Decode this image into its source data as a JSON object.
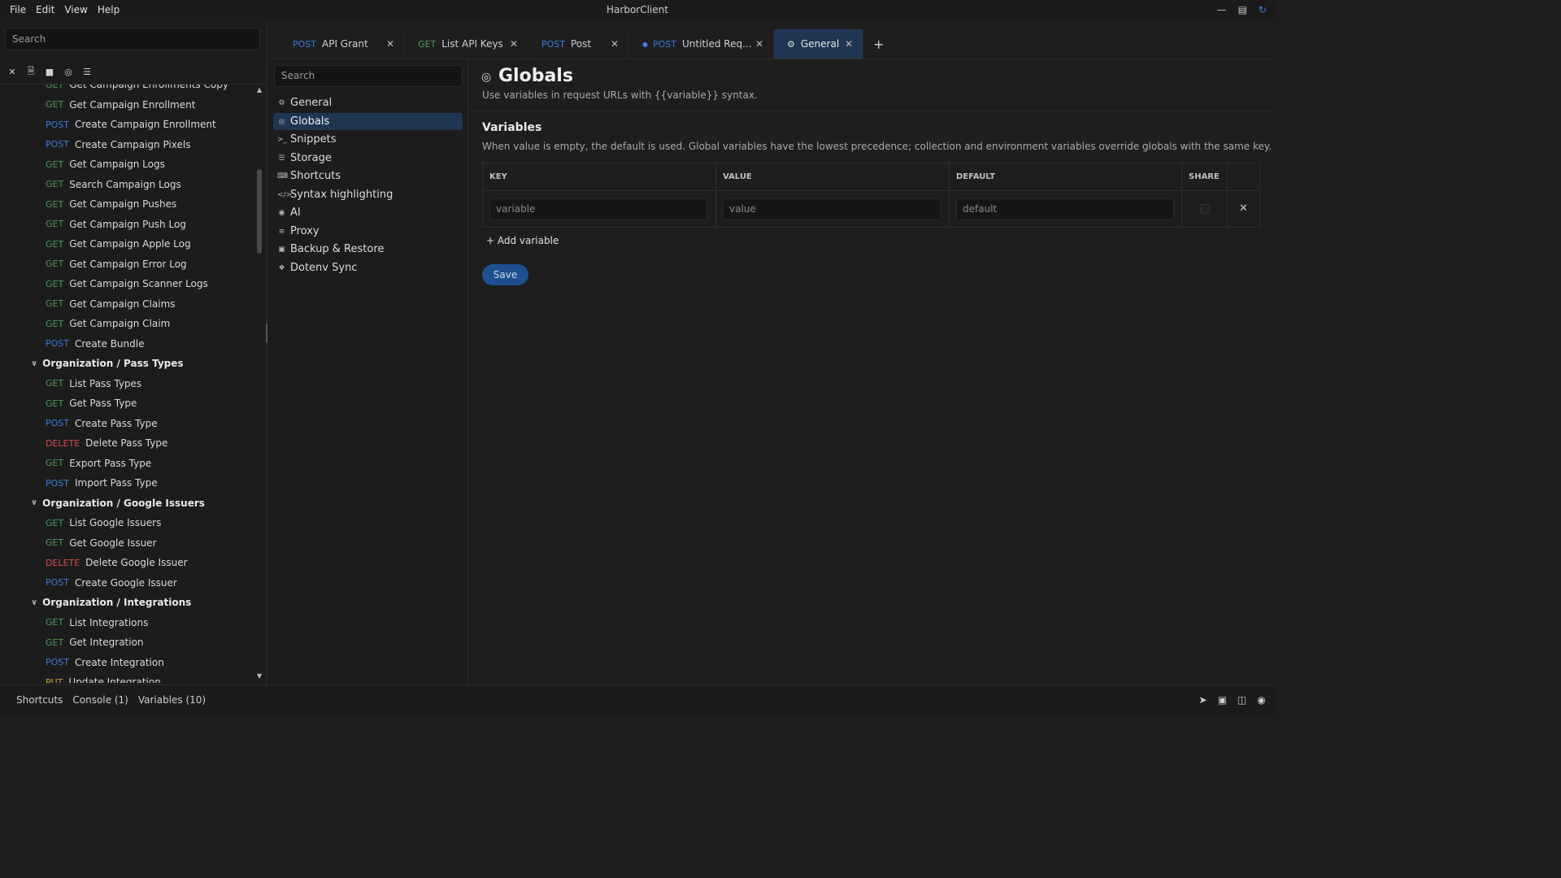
{
  "app": {
    "title": "HarborClient",
    "menu": [
      "File",
      "Edit",
      "View",
      "Help"
    ],
    "window_controls": [
      "minimize-icon",
      "maximize-icon",
      "sync-icon"
    ]
  },
  "sidebar": {
    "search_placeholder": "Search",
    "toolbar_icons": [
      "close-icon",
      "new-file-icon",
      "folder-icon",
      "globe-icon",
      "database-icon"
    ],
    "tree": [
      {
        "type": "request",
        "method": "GET",
        "name": "Get Campaign Enrollments Copy"
      },
      {
        "type": "request",
        "method": "GET",
        "name": "Get Campaign Enrollment"
      },
      {
        "type": "request",
        "method": "POST",
        "name": "Create Campaign Enrollment"
      },
      {
        "type": "request",
        "method": "POST",
        "name": "Create Campaign Pixels"
      },
      {
        "type": "request",
        "method": "GET",
        "name": "Get Campaign Logs"
      },
      {
        "type": "request",
        "method": "GET",
        "name": "Search Campaign Logs"
      },
      {
        "type": "request",
        "method": "GET",
        "name": "Get Campaign Pushes"
      },
      {
        "type": "request",
        "method": "GET",
        "name": "Get Campaign Push Log"
      },
      {
        "type": "request",
        "method": "GET",
        "name": "Get Campaign Apple Log"
      },
      {
        "type": "request",
        "method": "GET",
        "name": "Get Campaign Error Log"
      },
      {
        "type": "request",
        "method": "GET",
        "name": "Get Campaign Scanner Logs"
      },
      {
        "type": "request",
        "method": "GET",
        "name": "Get Campaign Claims"
      },
      {
        "type": "request",
        "method": "GET",
        "name": "Get Campaign Claim"
      },
      {
        "type": "request",
        "method": "POST",
        "name": "Create Bundle"
      },
      {
        "type": "folder",
        "name": "Organization / Pass Types"
      },
      {
        "type": "request",
        "method": "GET",
        "name": "List Pass Types"
      },
      {
        "type": "request",
        "method": "GET",
        "name": "Get Pass Type"
      },
      {
        "type": "request",
        "method": "POST",
        "name": "Create Pass Type"
      },
      {
        "type": "request",
        "method": "DELETE",
        "name": "Delete Pass Type"
      },
      {
        "type": "request",
        "method": "GET",
        "name": "Export Pass Type"
      },
      {
        "type": "request",
        "method": "POST",
        "name": "Import Pass Type"
      },
      {
        "type": "folder",
        "name": "Organization / Google Issuers"
      },
      {
        "type": "request",
        "method": "GET",
        "name": "List Google Issuers"
      },
      {
        "type": "request",
        "method": "GET",
        "name": "Get Google Issuer"
      },
      {
        "type": "request",
        "method": "DELETE",
        "name": "Delete Google Issuer"
      },
      {
        "type": "request",
        "method": "POST",
        "name": "Create Google Issuer"
      },
      {
        "type": "folder",
        "name": "Organization / Integrations"
      },
      {
        "type": "request",
        "method": "GET",
        "name": "List Integrations"
      },
      {
        "type": "request",
        "method": "GET",
        "name": "Get Integration"
      },
      {
        "type": "request",
        "method": "POST",
        "name": "Create Integration"
      },
      {
        "type": "request",
        "method": "PUT",
        "name": "Update Integration"
      }
    ]
  },
  "tabs": [
    {
      "method": "POST",
      "name": "API Grant",
      "active": false,
      "dirty": false
    },
    {
      "method": "GET",
      "name": "List API Keys",
      "active": false,
      "dirty": false
    },
    {
      "method": "POST",
      "name": "Post",
      "active": false,
      "dirty": false
    },
    {
      "method": "POST",
      "name": "Untitled Req...",
      "active": false,
      "dirty": true
    },
    {
      "method": "",
      "icon": "gear-icon",
      "name": "General",
      "active": true,
      "dirty": false
    }
  ],
  "settings_nav": {
    "search_placeholder": "Search",
    "items": [
      {
        "label": "General",
        "icon": "gear-icon",
        "active": false
      },
      {
        "label": "Globals",
        "icon": "globe-icon",
        "active": true
      },
      {
        "label": "Snippets",
        "icon": "terminal-icon",
        "active": false
      },
      {
        "label": "Storage",
        "icon": "database-icon",
        "active": false
      },
      {
        "label": "Shortcuts",
        "icon": "keyboard-icon",
        "active": false
      },
      {
        "label": "Syntax highlighting",
        "icon": "code-icon",
        "active": false
      },
      {
        "label": "AI",
        "icon": "robot-icon",
        "active": false
      },
      {
        "label": "Proxy",
        "icon": "server-icon",
        "active": false
      },
      {
        "label": "Backup & Restore",
        "icon": "save-icon",
        "active": false
      },
      {
        "label": "Dotenv Sync",
        "icon": "puzzle-icon",
        "active": false
      }
    ]
  },
  "page": {
    "title": "Globals",
    "subtitle": "Use variables in request URLs with {{variable}} syntax.",
    "section_title": "Variables",
    "section_desc": "When value is empty, the default is used. Global variables have the lowest precedence; collection and environment variables override globals with the same key.",
    "columns": [
      "KEY",
      "VALUE",
      "DEFAULT",
      "SHARE"
    ],
    "row": {
      "key_placeholder": "variable",
      "value_placeholder": "value",
      "default_placeholder": "default",
      "shared": false
    },
    "add_variable": "+ Add variable",
    "save": "Save"
  },
  "statusbar": {
    "items": [
      "Shortcuts",
      "Console (1)",
      "Variables (10)"
    ],
    "icons": [
      "send-icon",
      "inbox-icon",
      "layout-icon",
      "robot-icon"
    ]
  },
  "colors": {
    "GET": "#4a9a5a",
    "POST": "#3b7dd8",
    "DELETE": "#d94b4b",
    "PUT": "#c9a040",
    "accent": "#1f3552",
    "save_button": "#1f4f8f"
  }
}
